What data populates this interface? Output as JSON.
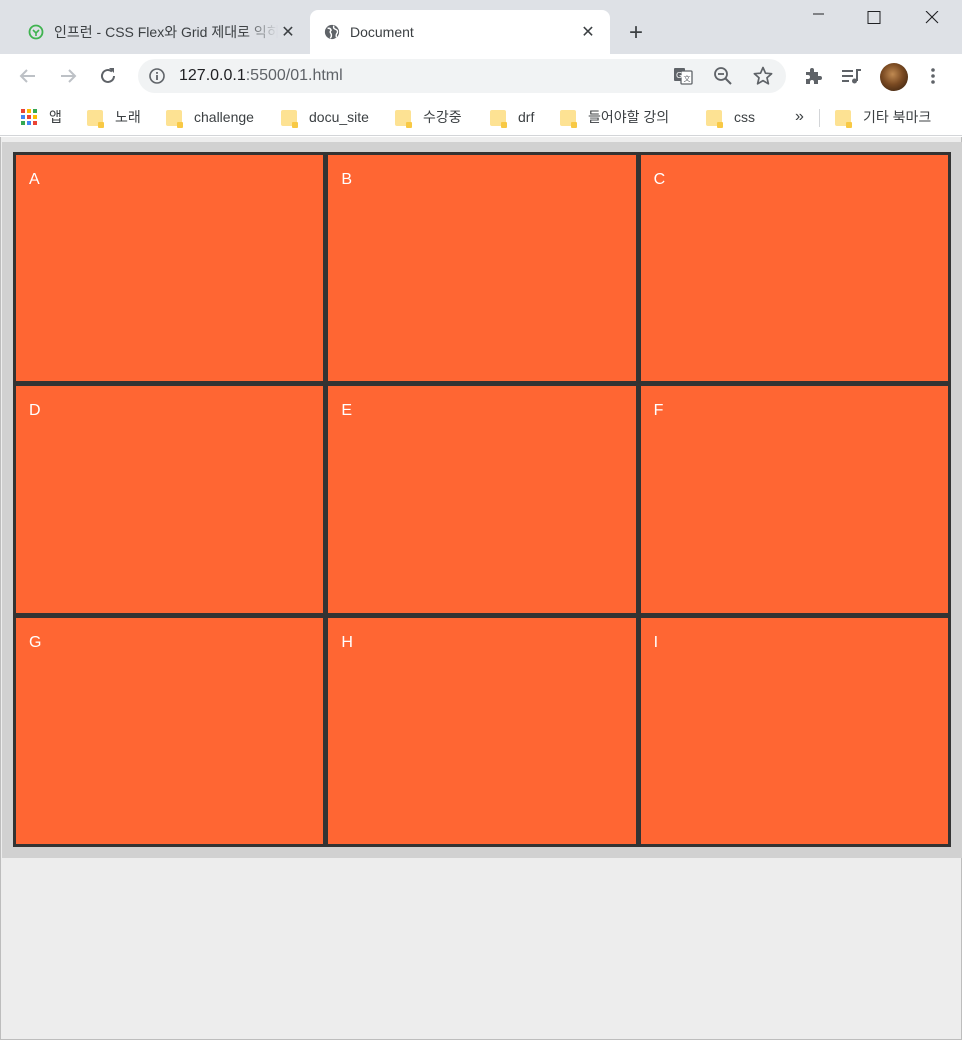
{
  "tabs": {
    "inactive": {
      "title": "인프런 - CSS Flex와 Grid 제대로 익히기",
      "close": "✕"
    },
    "active": {
      "title": "Document",
      "close": "✕"
    },
    "new_tab": "+"
  },
  "toolbar": {
    "url_host": "127.0.0.1",
    "url_rest": ":5500/01.html"
  },
  "bookmarks": {
    "apps": "앱",
    "items": [
      "노래",
      "challenge",
      "docu_site",
      "수강중",
      "drf",
      "들어야할 강의",
      "css"
    ],
    "overflow": "»",
    "other": "기타 북마크"
  },
  "grid": {
    "cells": [
      "A",
      "B",
      "C",
      "D",
      "E",
      "F",
      "G",
      "H",
      "I"
    ]
  },
  "colors": {
    "cell": "#ff6633",
    "cell_text": "#ffffff",
    "grid_border": "#333333",
    "container_bg": "#d1d1d1",
    "page_bg": "#ededed"
  },
  "icons": [
    "inflearn-favicon-icon",
    "globe-icon",
    "close-icon",
    "plus-icon",
    "minimize-icon",
    "maximize-icon",
    "window-close-icon",
    "back-arrow-icon",
    "forward-arrow-icon",
    "reload-icon",
    "info-icon",
    "translate-icon",
    "zoom-out-icon",
    "star-icon",
    "extensions-icon",
    "media-control-icon",
    "profile-avatar-icon",
    "menu-dots-icon",
    "apps-grid-icon",
    "folder-icon"
  ]
}
